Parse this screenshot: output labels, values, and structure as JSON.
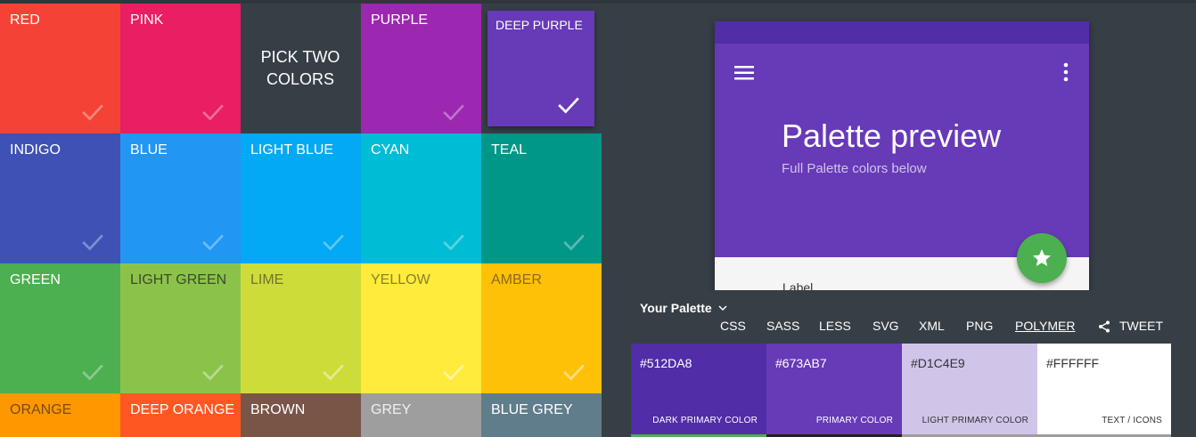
{
  "colors": {
    "red": "#f44336",
    "pink": "#e91e63",
    "purple": "#9c27b0",
    "deep_purple": "#673ab7",
    "indigo": "#3f51b5",
    "blue": "#2196f3",
    "light_blue": "#03a9f4",
    "cyan": "#00bcd4",
    "teal": "#009688",
    "green": "#4caf50",
    "light_green": "#8bc34a",
    "lime": "#cddc39",
    "yellow": "#ffeb3b",
    "amber": "#ffc107",
    "orange": "#ff9800",
    "deep_orange": "#ff5722",
    "brown": "#795548",
    "grey": "#9e9e9e",
    "blue_grey": "#607d8b",
    "background": "#373f46"
  },
  "grid": {
    "pick_text": "PICK TWO COLORS",
    "tiles": [
      {
        "label": "RED"
      },
      {
        "label": "PINK"
      },
      {
        "label": "PURPLE"
      },
      {
        "label": "DEEP PURPLE"
      },
      {
        "label": "INDIGO"
      },
      {
        "label": "BLUE"
      },
      {
        "label": "LIGHT BLUE"
      },
      {
        "label": "CYAN"
      },
      {
        "label": "TEAL"
      },
      {
        "label": "GREEN"
      },
      {
        "label": "LIGHT GREEN"
      },
      {
        "label": "LIME"
      },
      {
        "label": "YELLOW"
      },
      {
        "label": "AMBER"
      },
      {
        "label": "ORANGE"
      },
      {
        "label": "DEEP ORANGE"
      },
      {
        "label": "BROWN"
      },
      {
        "label": "GREY"
      },
      {
        "label": "BLUE GREY"
      }
    ],
    "selected": "DEEP PURPLE"
  },
  "preview": {
    "title": "Palette preview",
    "subtitle": "Full Palette colors below",
    "label": "Label",
    "icons": [
      "menu-icon",
      "more-vert-icon",
      "star-icon"
    ]
  },
  "palette": {
    "title": "Your Palette",
    "exports": [
      "CSS",
      "SASS",
      "LESS",
      "SVG",
      "XML",
      "PNG",
      "POLYMER",
      "TWEET"
    ],
    "swatches": [
      {
        "hex": "#512DA8",
        "role": "DARK PRIMARY COLOR"
      },
      {
        "hex": "#673AB7",
        "role": "PRIMARY COLOR"
      },
      {
        "hex": "#D1C4E9",
        "role": "LIGHT PRIMARY COLOR"
      },
      {
        "hex": "#FFFFFF",
        "role": "TEXT / ICONS"
      }
    ]
  }
}
